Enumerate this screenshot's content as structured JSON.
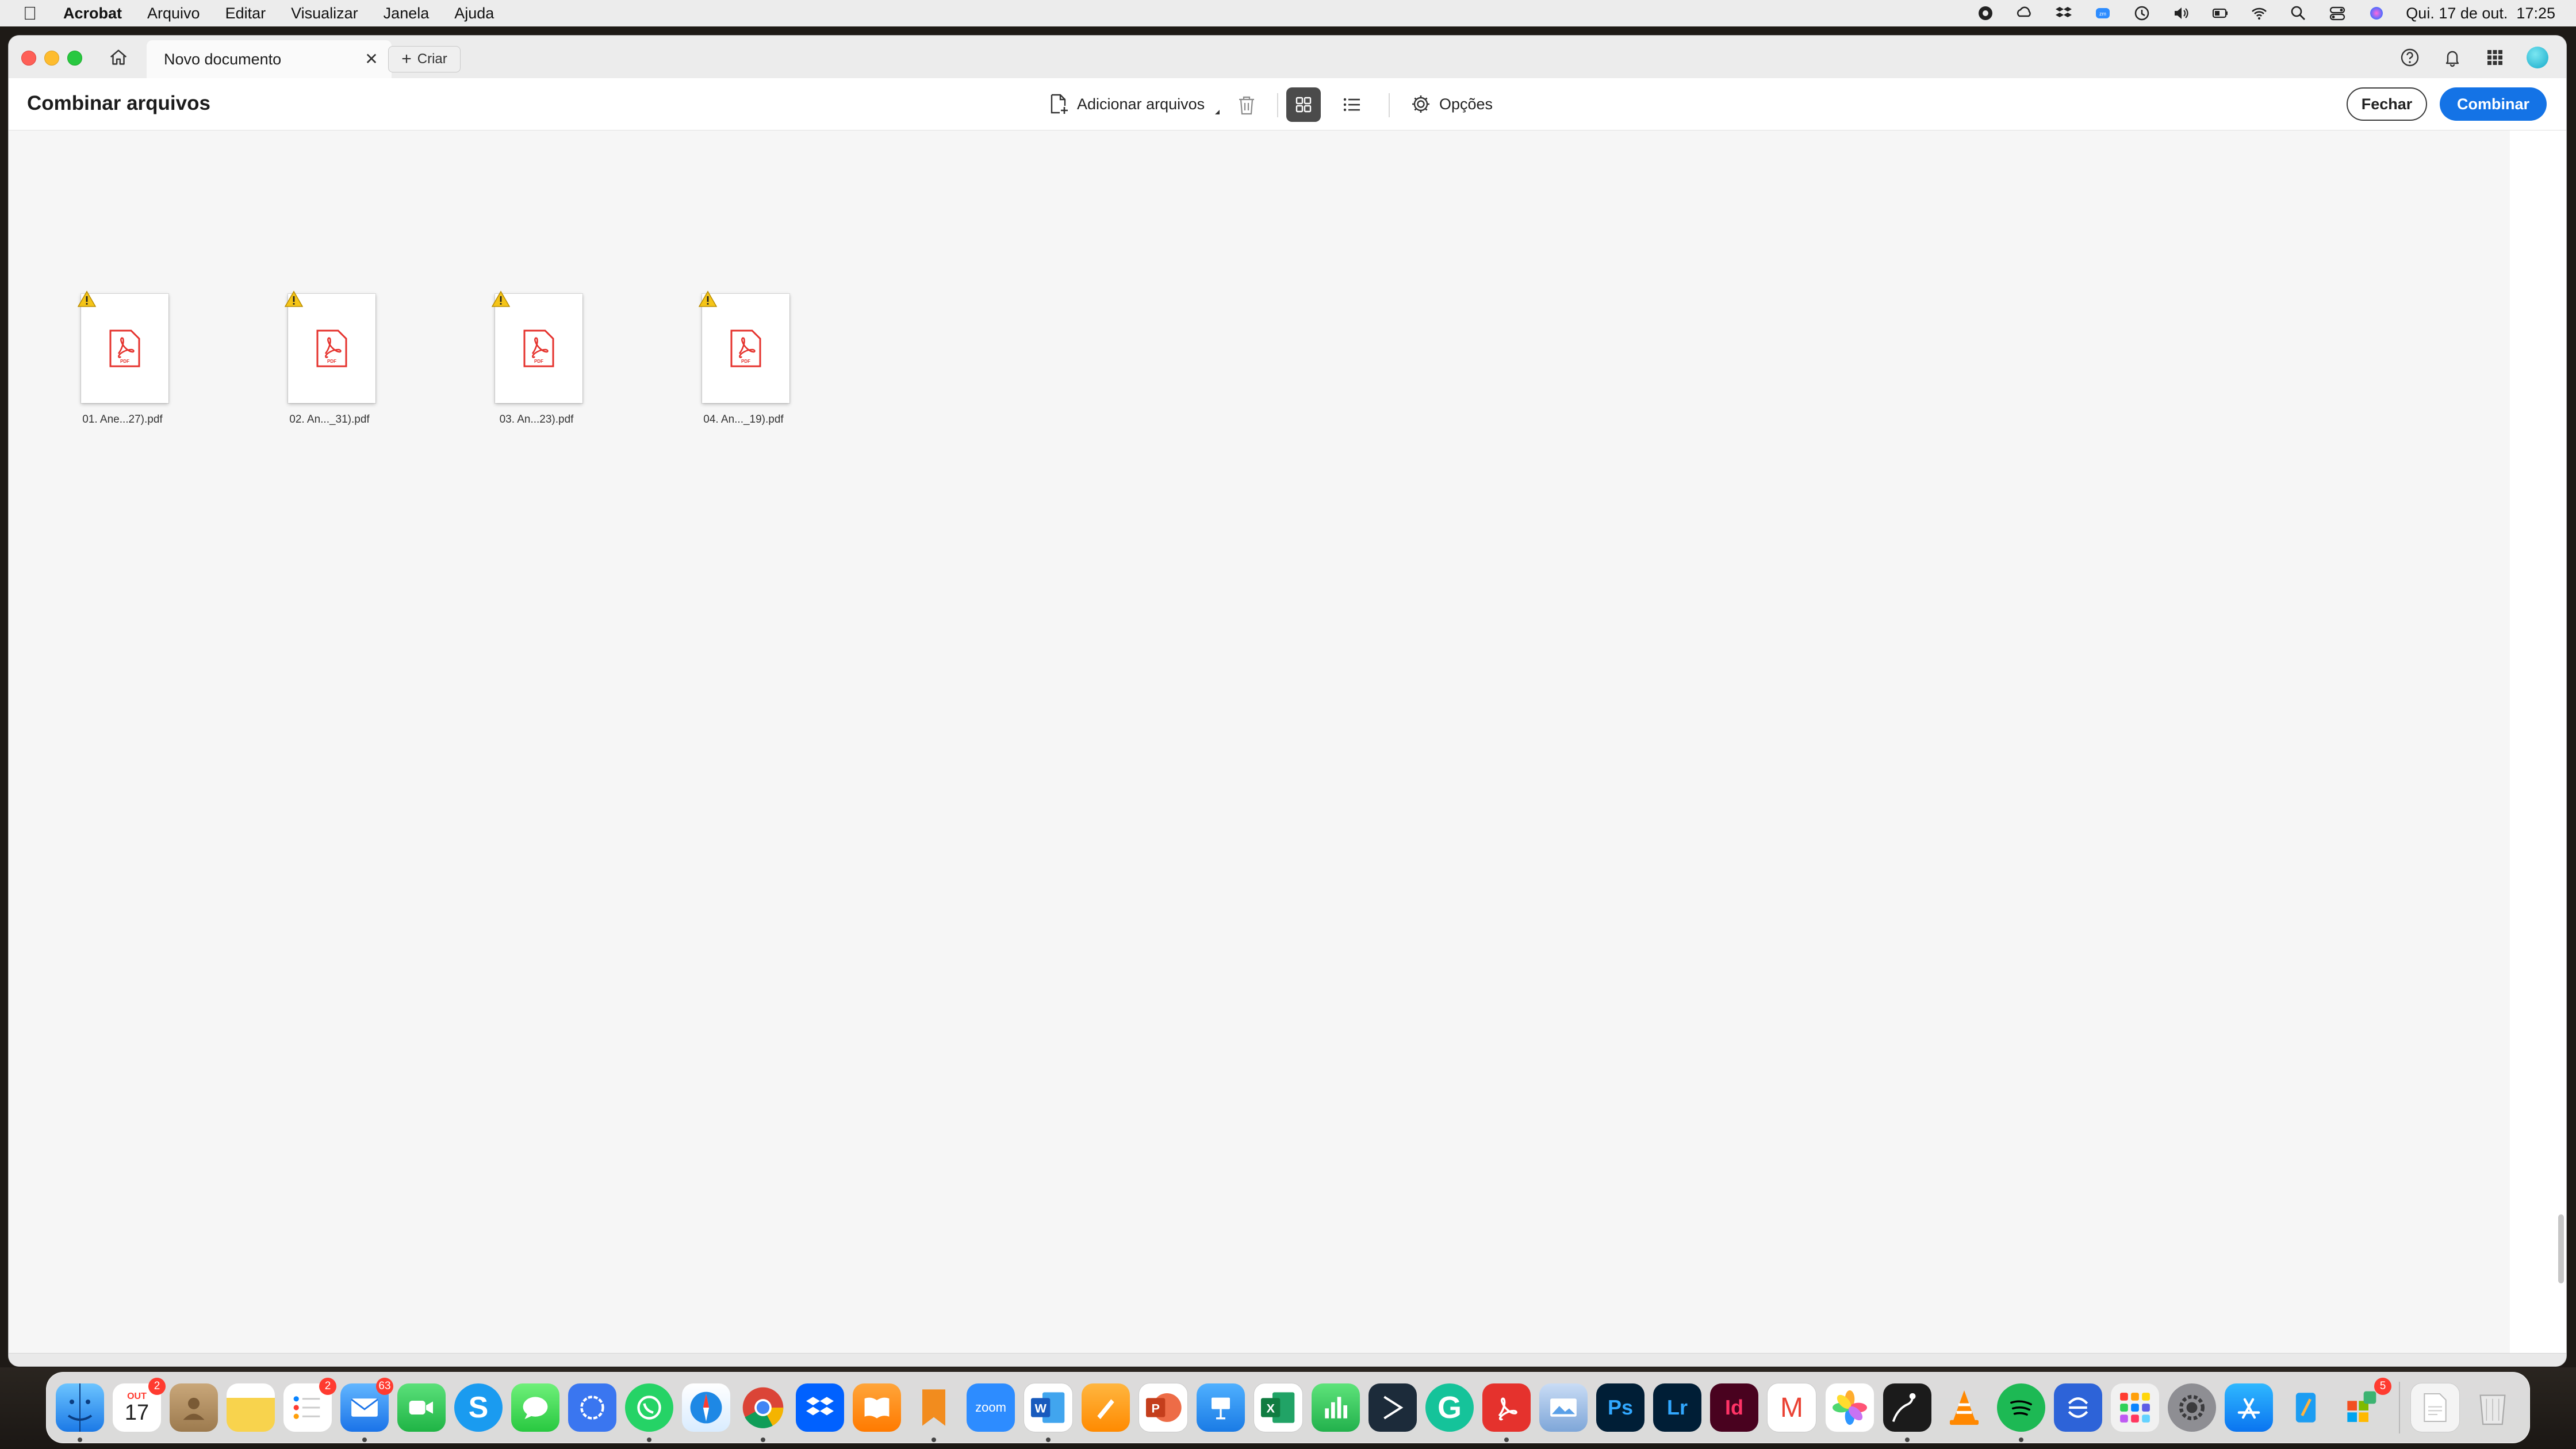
{
  "menubar": {
    "app_name": "Acrobat",
    "items": [
      "Arquivo",
      "Editar",
      "Visualizar",
      "Janela",
      "Ajuda"
    ],
    "clock": "Qui. 17 de out.  17:25",
    "status_icons": [
      "adobe-cc-icon",
      "creative-cloud-icon",
      "dropbox-icon",
      "zoom-icon",
      "time-machine-icon",
      "volume-icon",
      "battery-icon",
      "wifi-icon",
      "spotlight-icon",
      "control-center-icon",
      "siri-icon"
    ]
  },
  "tabbar": {
    "tab_label": "Novo documento",
    "create_label": "Criar"
  },
  "toolbar": {
    "title": "Combinar arquivos",
    "add_files_label": "Adicionar arquivos",
    "options_label": "Opções",
    "close_label": "Fechar",
    "combine_label": "Combinar"
  },
  "files": [
    {
      "name": "01. Ane...27).pdf",
      "warning": true
    },
    {
      "name": "02. An..._31).pdf",
      "warning": true
    },
    {
      "name": "03. An...23).pdf",
      "warning": true
    },
    {
      "name": "04. An..._19).pdf",
      "warning": true
    }
  ],
  "colors": {
    "accent": "#1473e6",
    "pdf_red": "#e5322d",
    "warning": "#f5c518"
  },
  "dock": {
    "calendar_month": "OUT",
    "calendar_day": "17",
    "calendar_badge": "2",
    "reminders_badge": "2",
    "mail_badge": "63",
    "zoom_label": "zoom",
    "other_badge": "5",
    "apps": [
      "finder",
      "calendar",
      "contacts",
      "notes",
      "reminders",
      "mail",
      "facetime",
      "skype",
      "messages",
      "signal",
      "whatsapp",
      "safari",
      "chrome",
      "dropbox",
      "books",
      "pages-bookmark",
      "zoom",
      "word",
      "pages",
      "powerpoint",
      "keynote",
      "excel",
      "numbers",
      "terminal",
      "grammarly",
      "acrobat",
      "preview",
      "photoshop",
      "lightroom",
      "indesign",
      "gmail",
      "photos",
      "kindle",
      "vlc",
      "spotify",
      "scanner",
      "launchpad",
      "system-settings",
      "app-store",
      "notes-app",
      "microsoft-apps",
      "downloads",
      "trash"
    ]
  }
}
